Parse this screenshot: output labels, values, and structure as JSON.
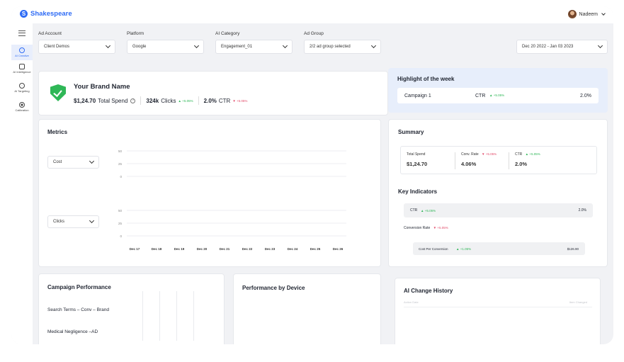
{
  "app": {
    "name": "Shakespeare",
    "logo_letter": "S"
  },
  "user": {
    "name": "Nadeem"
  },
  "sidebar": {
    "items": [
      {
        "label": "AI Creative",
        "icon": "target-circle-icon",
        "active": true
      },
      {
        "label": "AI Intelligence",
        "icon": "ai-chip-icon",
        "active": false
      },
      {
        "label": "AI Targeting",
        "icon": "crosshair-icon",
        "active": false
      },
      {
        "label": "Calibration",
        "icon": "dot-circle-icon",
        "active": false
      }
    ]
  },
  "filters": [
    {
      "label": "Ad Account",
      "value": "Client Demos"
    },
    {
      "label": "Platform",
      "value": "Google"
    },
    {
      "label": "AI Category",
      "value": "Engagement_01"
    },
    {
      "label": "Ad Group",
      "value": "2/2 ad group selected"
    }
  ],
  "date_range": "Dec 20 2022 - Jan 03 2023",
  "brand": {
    "name": "Your Brand Name",
    "spend_value": "$1,24.70",
    "spend_label": "Total Spend",
    "clicks_value": "324k",
    "clicks_label": "Clicks",
    "clicks_change": "▲ +5.05%",
    "ctr_value": "2.0%",
    "ctr_label": "CTR",
    "ctr_change": "▼ +5.05%"
  },
  "highlight": {
    "title": "Highlight of the week",
    "campaign": "Campaign 1",
    "metric": "CTR",
    "change": "▲ +5.05%",
    "value": "2.0%"
  },
  "metrics": {
    "title": "Metrics",
    "select1": "Cost",
    "select2": "Clicks",
    "ticks1": [
      "50",
      "25",
      "0"
    ],
    "ticks2": [
      "50",
      "25",
      "0"
    ],
    "x_dates": [
      "Dec 17",
      "Dec 18",
      "Dec 19",
      "Dec 20",
      "Dec 21",
      "Dec 22",
      "Dec 23",
      "Dec 24",
      "Dec 25",
      "Dec 26"
    ]
  },
  "summary": {
    "title": "Summary",
    "spend_label": "Total Spend",
    "spend_value": "$1,24.70",
    "conv_label": "Conv. Rate",
    "conv_change": "▼ +5.05%",
    "conv_value": "4.06%",
    "ctr_label": "CTR",
    "ctr_change": "▲ +5.05%",
    "ctr_value": "2.0%"
  },
  "key_indicators": {
    "title": "Key Indicators",
    "ctr_label": "CTR",
    "ctr_change": "▲ +5.05%",
    "ctr_value": "2.0%",
    "conv_label": "Conversion Rate",
    "conv_change": "▼ +5.05%",
    "cpc_label": "Cost Per Conversion",
    "cpc_change": "▲ +1.05%",
    "cpc_value": "$126.90"
  },
  "campaign_performance": {
    "title": "Campaign Performance",
    "rows": [
      "Search Terms – Conv – Brand",
      "Medical Negligence –AD"
    ]
  },
  "device": {
    "title": "Performance by Device"
  },
  "ai_history": {
    "title": "AI Change History",
    "col1": "Action Date",
    "col2": "Item Changed"
  },
  "colors": {
    "brand": "#2f6cf5",
    "positive": "#2fb757",
    "negative": "#e24b6a",
    "highlight_bg": "#e7eefb"
  }
}
